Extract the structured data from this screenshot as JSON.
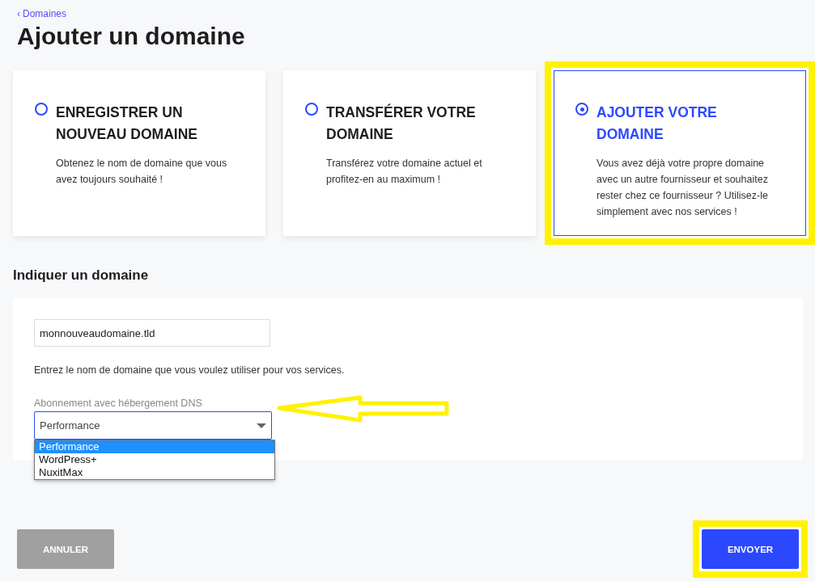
{
  "breadcrumb": {
    "icon": "‹",
    "label": "Domaines"
  },
  "title": "Ajouter un domaine",
  "cards": [
    {
      "title": "ENREGISTRER UN NOUVEAU DOMAINE",
      "description": "Obtenez le nom de domaine que vous avez toujours souhaité !",
      "selected": false,
      "highlighted": false
    },
    {
      "title": "TRANSFÉRER VOTRE DOMAINE",
      "description": "Transférez votre domaine actuel et profitez-en au maximum !",
      "selected": false,
      "highlighted": false
    },
    {
      "title": "AJOUTER VOTRE DOMAINE",
      "description": "Vous avez déjà votre propre domaine avec un autre fournisseur et souhaitez rester chez ce fournisseur ? Utilisez-le simplement avec nos services !",
      "selected": true,
      "highlighted": true
    }
  ],
  "section_title": "Indiquer un domaine",
  "domain_field": {
    "value": "monnouveaudomaine.tld",
    "help": "Entrez le nom de domaine que vous voulez utiliser pour vos services."
  },
  "plan_select": {
    "label": "Abonnement avec hébergement DNS",
    "value": "Performance",
    "expanded": true,
    "arrow_annotation": true,
    "options": [
      {
        "label": "Performance",
        "selected": true
      },
      {
        "label": "WordPress+",
        "selected": false
      },
      {
        "label": "NuxitMax",
        "selected": false
      }
    ]
  },
  "buttons": [
    {
      "label": "ANNULER",
      "kind": "secondary",
      "highlighted": false
    },
    {
      "label": "ENVOYER",
      "kind": "primary",
      "highlighted": true
    }
  ]
}
